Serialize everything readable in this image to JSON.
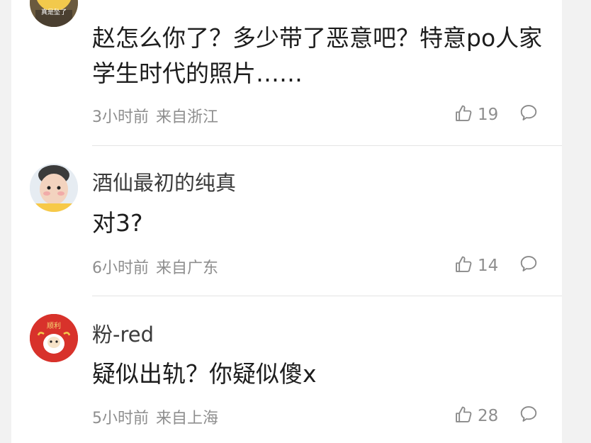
{
  "comments": [
    {
      "username": "",
      "avatar_text": "真是坠了",
      "text": "赵怎么你了？多少带了恶意吧？特意po人家学生时代的照片……",
      "time": "3小时前",
      "location": "来自浙江",
      "likes": "19"
    },
    {
      "username": "酒仙最初的纯真",
      "text": "对3?",
      "time": "6小时前",
      "location": "来自广东",
      "likes": "14"
    },
    {
      "username": "粉-red",
      "avatar_text": "顺利",
      "text": "疑似出轨？你疑似傻x",
      "time": "5小时前",
      "location": "来自上海",
      "likes": "28"
    }
  ],
  "colors": {
    "background": "#f2f2f2",
    "card": "#ffffff",
    "text_primary": "#1d1d1d",
    "text_secondary": "#8e8e8e",
    "divider": "#e4e4e4"
  },
  "icons": {
    "like": "thumbs-up-outline-icon",
    "reply": "speech-bubble-outline-icon"
  }
}
